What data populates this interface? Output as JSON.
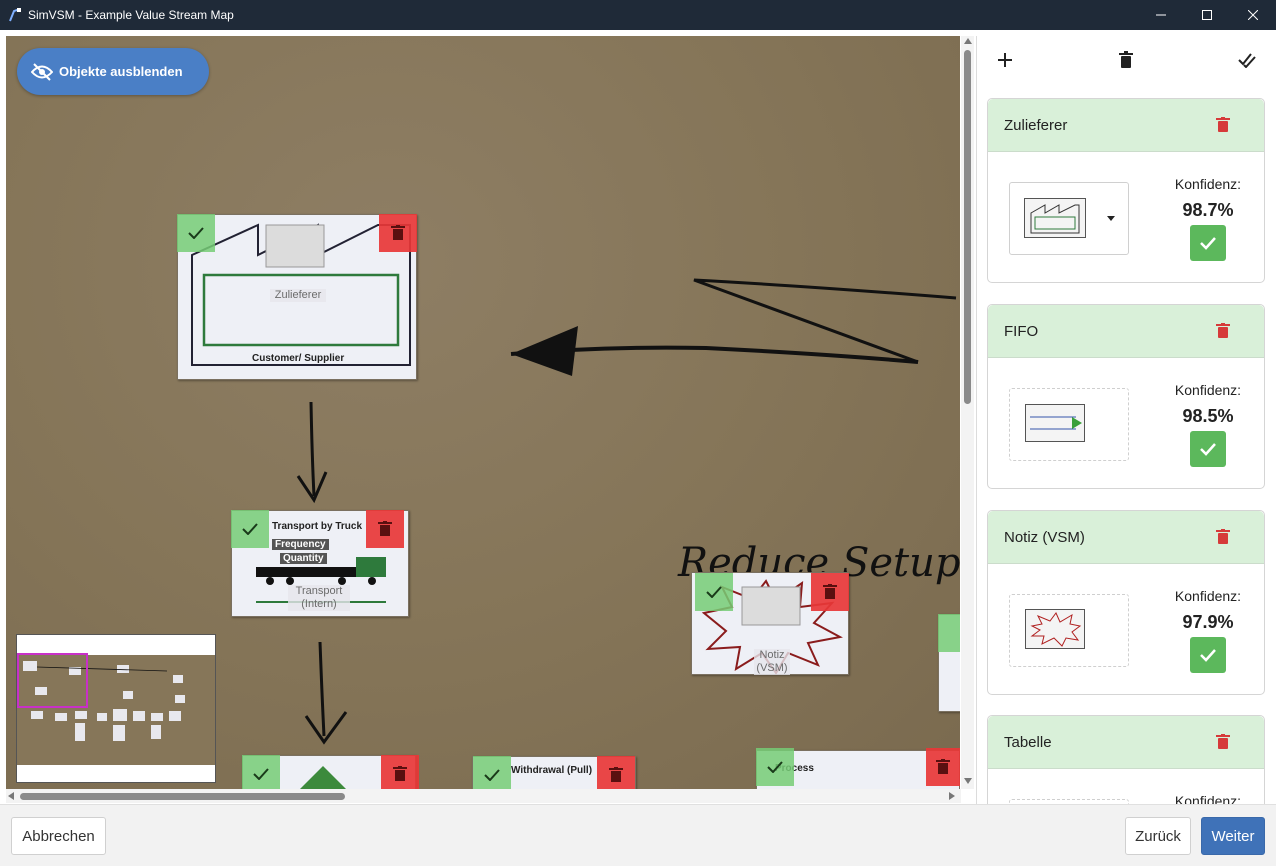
{
  "window": {
    "title": "SimVSM - Example Value Stream Map"
  },
  "canvas": {
    "hide_objects_label": "Objekte ausblenden",
    "objects": [
      {
        "label": "Zulieferer",
        "card_text": "Customer/ Supplier"
      },
      {
        "label": "Transport\n(Intern)",
        "card_text_1": "Transport by Truck",
        "card_text_2": "Frequency",
        "card_text_3": "Quantity"
      },
      {
        "label": "Notiz\n(VSM)"
      },
      {
        "card_text": "Withdrawal (Pull)"
      },
      {
        "card_text": "Process"
      }
    ],
    "handwriting": "Reduce Setup"
  },
  "panel": {
    "toolbar": {
      "add_icon": "plus-icon",
      "delete_icon": "trash-icon",
      "confirm_all_icon": "double-check-icon"
    },
    "entries": [
      {
        "title": "Zulieferer",
        "confidence_label": "Konfidenz:",
        "confidence": "98.7%",
        "has_dropdown": true
      },
      {
        "title": "FIFO",
        "confidence_label": "Konfidenz:",
        "confidence": "98.5%"
      },
      {
        "title": "Notiz (VSM)",
        "confidence_label": "Konfidenz:",
        "confidence": "97.9%"
      },
      {
        "title": "Tabelle",
        "confidence_label": "Konfidenz:",
        "confidence": ""
      }
    ]
  },
  "footer": {
    "cancel_label": "Abbrechen",
    "back_label": "Zurück",
    "next_label": "Weiter"
  },
  "colors": {
    "titlebar": "#1f2a38",
    "primary": "#3f72b8",
    "confirm_green": "#5cb85c",
    "delete_red": "#e83737",
    "entry_header": "#d9f0d9"
  }
}
